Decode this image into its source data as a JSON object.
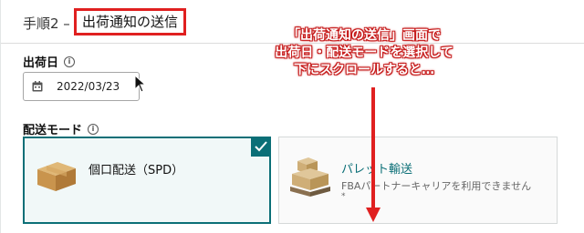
{
  "header": {
    "step_prefix": "手順2 –",
    "title": "出荷通知の送信"
  },
  "ship_date": {
    "label": "出荷日",
    "info_icon": "info-icon",
    "value": "2022/03/23",
    "calendar_icon": "calendar-icon"
  },
  "shipping_mode": {
    "label": "配送モード",
    "info_icon": "info-icon",
    "options": [
      {
        "title": "個口配送（SPD）",
        "selected": true,
        "icon": "box-icon"
      },
      {
        "title": "パレット輸送",
        "description": "FBAパートナーキャリアを利用できません",
        "note": "*",
        "selected": false,
        "icon": "pallet-icon"
      }
    ]
  },
  "annotation": {
    "lines": [
      "「出荷通知の送信」画面で",
      "出荷日・配送モードを選択して",
      "下にスクロールすると…"
    ],
    "color": "#c61c1c"
  },
  "colors": {
    "accent": "#0b6f77",
    "highlight": "#e02020"
  }
}
